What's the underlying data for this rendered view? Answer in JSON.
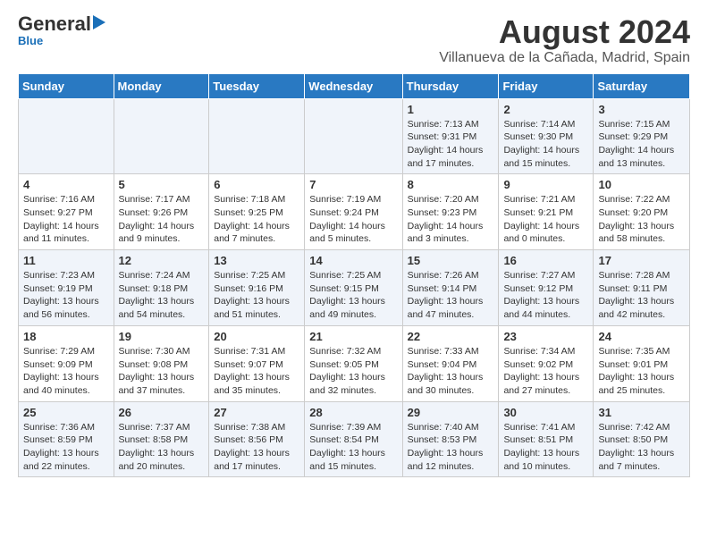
{
  "logo": {
    "general": "General",
    "blue": "Blue"
  },
  "title": "August 2024",
  "subtitle": "Villanueva de la Cañada, Madrid, Spain",
  "headers": [
    "Sunday",
    "Monday",
    "Tuesday",
    "Wednesday",
    "Thursday",
    "Friday",
    "Saturday"
  ],
  "weeks": [
    [
      {
        "day": "",
        "info": ""
      },
      {
        "day": "",
        "info": ""
      },
      {
        "day": "",
        "info": ""
      },
      {
        "day": "",
        "info": ""
      },
      {
        "day": "1",
        "info": "Sunrise: 7:13 AM\nSunset: 9:31 PM\nDaylight: 14 hours\nand 17 minutes."
      },
      {
        "day": "2",
        "info": "Sunrise: 7:14 AM\nSunset: 9:30 PM\nDaylight: 14 hours\nand 15 minutes."
      },
      {
        "day": "3",
        "info": "Sunrise: 7:15 AM\nSunset: 9:29 PM\nDaylight: 14 hours\nand 13 minutes."
      }
    ],
    [
      {
        "day": "4",
        "info": "Sunrise: 7:16 AM\nSunset: 9:27 PM\nDaylight: 14 hours\nand 11 minutes."
      },
      {
        "day": "5",
        "info": "Sunrise: 7:17 AM\nSunset: 9:26 PM\nDaylight: 14 hours\nand 9 minutes."
      },
      {
        "day": "6",
        "info": "Sunrise: 7:18 AM\nSunset: 9:25 PM\nDaylight: 14 hours\nand 7 minutes."
      },
      {
        "day": "7",
        "info": "Sunrise: 7:19 AM\nSunset: 9:24 PM\nDaylight: 14 hours\nand 5 minutes."
      },
      {
        "day": "8",
        "info": "Sunrise: 7:20 AM\nSunset: 9:23 PM\nDaylight: 14 hours\nand 3 minutes."
      },
      {
        "day": "9",
        "info": "Sunrise: 7:21 AM\nSunset: 9:21 PM\nDaylight: 14 hours\nand 0 minutes."
      },
      {
        "day": "10",
        "info": "Sunrise: 7:22 AM\nSunset: 9:20 PM\nDaylight: 13 hours\nand 58 minutes."
      }
    ],
    [
      {
        "day": "11",
        "info": "Sunrise: 7:23 AM\nSunset: 9:19 PM\nDaylight: 13 hours\nand 56 minutes."
      },
      {
        "day": "12",
        "info": "Sunrise: 7:24 AM\nSunset: 9:18 PM\nDaylight: 13 hours\nand 54 minutes."
      },
      {
        "day": "13",
        "info": "Sunrise: 7:25 AM\nSunset: 9:16 PM\nDaylight: 13 hours\nand 51 minutes."
      },
      {
        "day": "14",
        "info": "Sunrise: 7:25 AM\nSunset: 9:15 PM\nDaylight: 13 hours\nand 49 minutes."
      },
      {
        "day": "15",
        "info": "Sunrise: 7:26 AM\nSunset: 9:14 PM\nDaylight: 13 hours\nand 47 minutes."
      },
      {
        "day": "16",
        "info": "Sunrise: 7:27 AM\nSunset: 9:12 PM\nDaylight: 13 hours\nand 44 minutes."
      },
      {
        "day": "17",
        "info": "Sunrise: 7:28 AM\nSunset: 9:11 PM\nDaylight: 13 hours\nand 42 minutes."
      }
    ],
    [
      {
        "day": "18",
        "info": "Sunrise: 7:29 AM\nSunset: 9:09 PM\nDaylight: 13 hours\nand 40 minutes."
      },
      {
        "day": "19",
        "info": "Sunrise: 7:30 AM\nSunset: 9:08 PM\nDaylight: 13 hours\nand 37 minutes."
      },
      {
        "day": "20",
        "info": "Sunrise: 7:31 AM\nSunset: 9:07 PM\nDaylight: 13 hours\nand 35 minutes."
      },
      {
        "day": "21",
        "info": "Sunrise: 7:32 AM\nSunset: 9:05 PM\nDaylight: 13 hours\nand 32 minutes."
      },
      {
        "day": "22",
        "info": "Sunrise: 7:33 AM\nSunset: 9:04 PM\nDaylight: 13 hours\nand 30 minutes."
      },
      {
        "day": "23",
        "info": "Sunrise: 7:34 AM\nSunset: 9:02 PM\nDaylight: 13 hours\nand 27 minutes."
      },
      {
        "day": "24",
        "info": "Sunrise: 7:35 AM\nSunset: 9:01 PM\nDaylight: 13 hours\nand 25 minutes."
      }
    ],
    [
      {
        "day": "25",
        "info": "Sunrise: 7:36 AM\nSunset: 8:59 PM\nDaylight: 13 hours\nand 22 minutes."
      },
      {
        "day": "26",
        "info": "Sunrise: 7:37 AM\nSunset: 8:58 PM\nDaylight: 13 hours\nand 20 minutes."
      },
      {
        "day": "27",
        "info": "Sunrise: 7:38 AM\nSunset: 8:56 PM\nDaylight: 13 hours\nand 17 minutes."
      },
      {
        "day": "28",
        "info": "Sunrise: 7:39 AM\nSunset: 8:54 PM\nDaylight: 13 hours\nand 15 minutes."
      },
      {
        "day": "29",
        "info": "Sunrise: 7:40 AM\nSunset: 8:53 PM\nDaylight: 13 hours\nand 12 minutes."
      },
      {
        "day": "30",
        "info": "Sunrise: 7:41 AM\nSunset: 8:51 PM\nDaylight: 13 hours\nand 10 minutes."
      },
      {
        "day": "31",
        "info": "Sunrise: 7:42 AM\nSunset: 8:50 PM\nDaylight: 13 hours\nand 7 minutes."
      }
    ]
  ]
}
